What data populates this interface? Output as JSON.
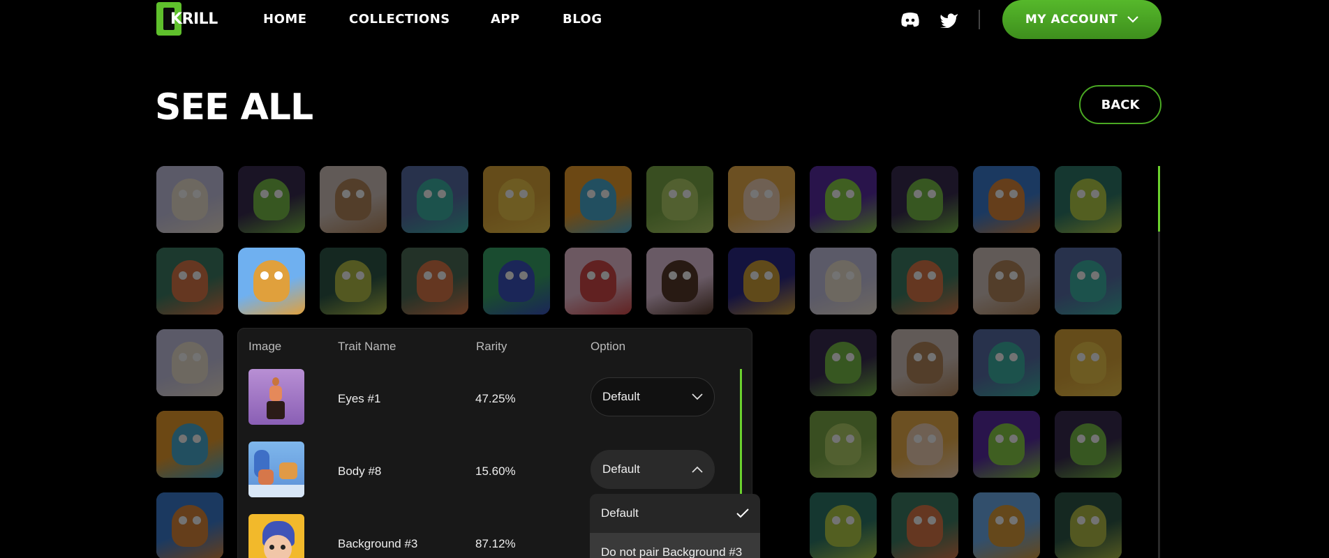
{
  "brand": {
    "name": "KRILL"
  },
  "nav": {
    "items": [
      "HOME",
      "COLLECTIONS",
      "APP",
      "BLOG"
    ]
  },
  "social": {
    "icons": [
      "discord-icon",
      "twitter-icon"
    ]
  },
  "account": {
    "label": "MY ACCOUNT"
  },
  "page": {
    "title": "SEE ALL",
    "back_label": "BACK"
  },
  "colors": {
    "accent": "#5fc02c",
    "accent_dark": "#3e8f1d",
    "panel": "#181818",
    "background": "#000000"
  },
  "trait_table": {
    "headers": [
      "Image",
      "Trait Name",
      "Rarity",
      "Option"
    ],
    "rows": [
      {
        "name": "Eyes #1",
        "rarity": "47.25%",
        "option": "Default"
      },
      {
        "name": "Body #8",
        "rarity": "15.60%",
        "option": "Default"
      },
      {
        "name": "Background #3",
        "rarity": "87.12%"
      }
    ]
  },
  "dropdown": {
    "options": [
      "Default",
      "Do not pair Background #3"
    ],
    "selected": "Default"
  }
}
